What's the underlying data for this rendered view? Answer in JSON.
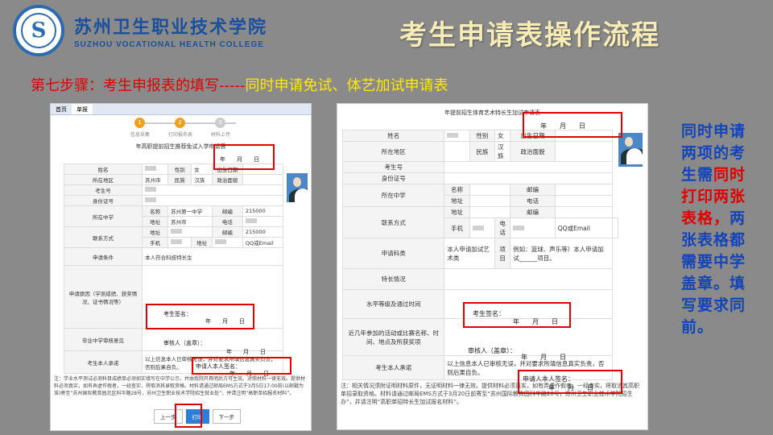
{
  "header": {
    "school_cn": "苏州卫生职业技术学院",
    "school_en": "SUZHOU VOCATIONAL HEALTH COLLEGE",
    "title": "考生申请表操作流程"
  },
  "step": {
    "part1": "第七步骤：考生申报表的填写-----",
    "part2": "同时申请免试、体艺加试申请表"
  },
  "panel1": {
    "tabs": [
      "首页",
      "单报"
    ],
    "steps": [
      {
        "num": "1",
        "label": "信息采集"
      },
      {
        "num": "2",
        "label": "打印报名表"
      },
      {
        "num": "3",
        "label": "材料上传"
      }
    ],
    "form_title": "年高职提前招生推荐免试入学申请表",
    "date_label": "年　　月　　日",
    "rows": {
      "name": "姓名",
      "gender": "性别",
      "gender_val": "女",
      "birth": "出生日期",
      "region": "所在地区",
      "region_val": "苏州市",
      "ethnic": "民族",
      "ethnic_val": "汉族",
      "politics": "政治面貌",
      "exam_no": "考生号",
      "id_no": "身份证号",
      "school": "所在中学",
      "sch_name": "名称",
      "sch_name_val": "苏州第一中学",
      "postcode": "邮编",
      "postcode_val": "215000",
      "address": "地址",
      "address_val": "苏州市",
      "phone": "电话",
      "contact": "联系方式",
      "c_address": "地址",
      "c_postcode": "邮编",
      "c_postcode_val": "215000",
      "mobile": "手机",
      "c_address2": "地址",
      "qq": "QQ或Email",
      "condition": "申请条件",
      "condition_val": "本人符合科技特长生",
      "reason": "申请原因（学测成绩、获奖情况、证书情况等）",
      "school_review": "毕业中学审核意见",
      "promise": "考生本人承诺",
      "promise_text": "以上信息本人已审核无误，并对要求所填信息真实负责，否则后果自负。"
    },
    "sign_label": "考生签名：",
    "sign_date": "年　　月　　日",
    "reviewer_label": "审核人（盖章）：",
    "reviewer_date": "年　　月　　日",
    "apply_sign": "申请人本人签名：",
    "apply_date": "年　　月　　日",
    "note": "注：学业水平测试必测科目成绩单必须如实填写在中学公示，并由我院开具明后方可生效。对照材料一律无效。提供材料必须真实，如有弄虚作假者，一经查实，将取消其录取资格。材料请通过邮局EMS方式于3月5日17:00前(以邮戳为准)寄至“苏州国际教育园北区科华路28号，苏州卫生职业技术学院招生就业处”，并请注明“高职单招报名材料”。",
    "buttons": {
      "prev": "上一步",
      "print": "打印",
      "next": "下一步"
    }
  },
  "panel2": {
    "form_title": "年提前招生体育艺术特长生加试申请表",
    "date_label": "年　　月　　日",
    "rows": {
      "name": "姓名",
      "gender": "性别",
      "gender_val": "女",
      "birth": "出生日期",
      "region": "所在地区",
      "ethnic": "民族",
      "ethnic_val": "汉族",
      "politics": "政治面貌",
      "exam_no": "考生号",
      "id_no": "身份证号",
      "school": "所在中学",
      "sch_name": "名称",
      "postcode": "邮编",
      "address": "地址",
      "phone": "电话",
      "contact": "联系方式",
      "c_address": "地址",
      "c_postcode": "邮编",
      "mobile": "手机",
      "c_phone": "电话",
      "qq": "QQ或Email",
      "subject": "申请科类",
      "subject_val": "本人申请加试艺术类",
      "item": "项目",
      "item_example": "例如：篮球、声乐等）本人申请加试______项目。",
      "specialty": "特长情况",
      "level": "水平等级及通过时间",
      "activities": "近几年参加的活动或比赛名称、时间、地点及所获奖项",
      "promise": "考生本人承诺",
      "promise_text": "以上信息本人已审核无误，并对要求所填信息真实负责，否则后果自负。"
    },
    "sign_label": "考生签名：",
    "sign_date": "年　　月　　日",
    "reviewer_label": "审核人（盖章）：",
    "reviewer_date": "年　　月　　日",
    "apply_sign": "申请人本人签名：",
    "apply_date": "年　　月　　日",
    "note": "注：相关情况须附证明材料原件，无证明材料一律无效。提供材料必须真实，如有弄虚作假者，一经查实，将取消其高职单招录取资格。材料请通过邮局EMS方式于3月20日前寄至“苏州国际教育园科华路28号，苏州卫生职业技术学院招生办”，并请注明“高职单招特长生加试报名材料”。"
  },
  "side_note": {
    "part1": "同时申请两项的考生需",
    "part2": "同时打印两张表格，",
    "part3": "两张表格都需要中学盖章。填写要求同前。"
  },
  "colors": {
    "accent_red": "#e30000",
    "side_blue": "#1344b8",
    "title_yellow": "#f7ecb5"
  }
}
